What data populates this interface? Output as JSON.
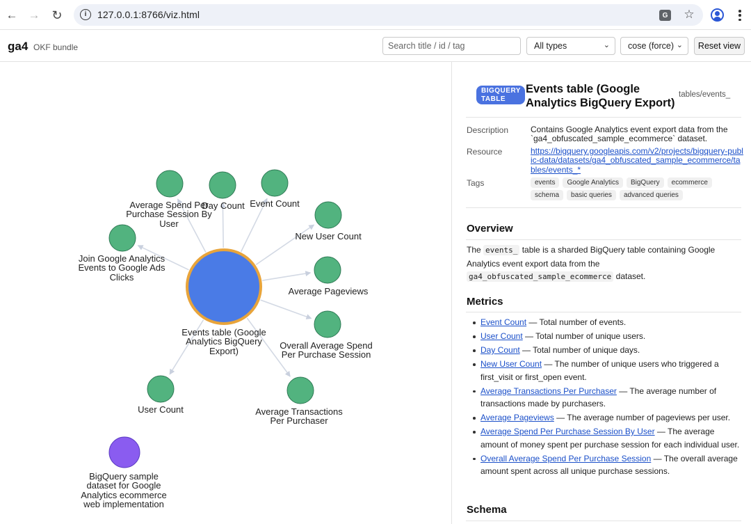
{
  "browser": {
    "url": "127.0.0.1:8766/viz.html"
  },
  "header": {
    "brand": "ga4",
    "subtitle": "OKF bundle",
    "search_placeholder": "Search title / id / tag",
    "type_filter": "All types",
    "layout_select": "cose (force)",
    "reset_label": "Reset view"
  },
  "graph": {
    "center": {
      "label_lines": [
        "Events table (Google",
        "Analytics BigQuery",
        "Export)"
      ],
      "color": "#4a7be6",
      "border": "#e8a43b"
    },
    "metric_color": "#52b37f",
    "dataset_color": "#8a5cf0",
    "nodes": [
      {
        "label_lines": [
          "Average Spend Per",
          "Purchase Session By",
          "User"
        ]
      },
      {
        "label_lines": [
          "Day Count"
        ]
      },
      {
        "label_lines": [
          "Event Count"
        ]
      },
      {
        "label_lines": [
          "New User Count"
        ]
      },
      {
        "label_lines": [
          "Join Google Analytics",
          "Events to Google Ads",
          "Clicks"
        ]
      },
      {
        "label_lines": [
          "Average Pageviews"
        ]
      },
      {
        "label_lines": [
          "Overall Average Spend",
          "Per Purchase Session"
        ]
      },
      {
        "label_lines": [
          "User Count"
        ]
      },
      {
        "label_lines": [
          "Average Transactions",
          "Per Purchaser"
        ]
      },
      {
        "label_lines": [
          "BigQuery sample",
          "dataset for Google",
          "Analytics ecommerce",
          "web implementation"
        ]
      }
    ]
  },
  "panel": {
    "badge_lines": [
      "BIGQUERY",
      "TABLE"
    ],
    "title": "Events table (Google Analytics BigQuery Export)",
    "id": "tables/events_",
    "description_label": "Description",
    "description": "Contains Google Analytics event export data from the `ga4_obfuscated_sample_ecommerce` dataset.",
    "resource_label": "Resource",
    "resource_url": "https://bigquery.googleapis.com/v2/projects/bigquery-public-data/datasets/ga4_obfuscated_sample_ecommerce/tables/events_*",
    "tags_label": "Tags",
    "tags": [
      "events",
      "Google Analytics",
      "BigQuery",
      "ecommerce",
      "schema",
      "basic queries",
      "advanced queries"
    ],
    "overview_heading": "Overview",
    "overview": {
      "pre": "The ",
      "code1": "events_",
      "mid": " table is a sharded BigQuery table containing Google Analytics event export data from the ",
      "code2": "ga4_obfuscated_sample_ecommerce",
      "post": " dataset."
    },
    "metrics_heading": "Metrics",
    "metrics": [
      {
        "name": "Event Count",
        "desc": " — Total number of events."
      },
      {
        "name": "User Count",
        "desc": " — Total number of unique users."
      },
      {
        "name": "Day Count",
        "desc": " — Total number of unique days."
      },
      {
        "name": "New User Count",
        "desc": " — The number of unique users who triggered a first_visit or first_open event."
      },
      {
        "name": "Average Transactions Per Purchaser",
        "desc": " — The average number of transactions made by purchasers."
      },
      {
        "name": "Average Pageviews",
        "desc": " — The average number of pageviews per user."
      },
      {
        "name": "Average Spend Per Purchase Session By User",
        "desc": " — The average amount of money spent per purchase session for each individual user."
      },
      {
        "name": "Overall Average Spend Per Purchase Session",
        "desc": " — The overall average amount spent across all unique purchase sessions."
      }
    ],
    "schema_heading": "Schema"
  }
}
